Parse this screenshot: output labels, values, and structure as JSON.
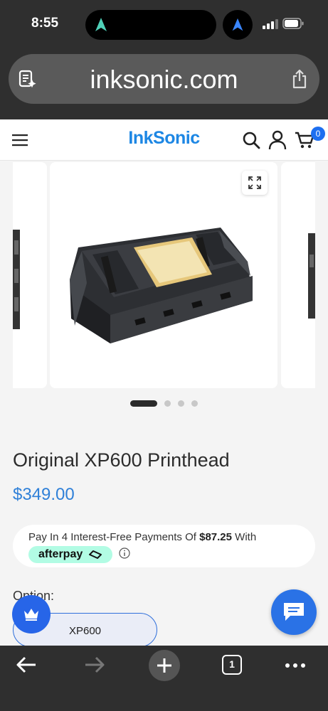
{
  "status_bar": {
    "time": "8:55"
  },
  "browser": {
    "url": "inksonic.com",
    "tab_count": "1"
  },
  "site": {
    "logo": "InkSonic",
    "cart_count": "0"
  },
  "gallery": {
    "slide_count": 4,
    "active_index": 0
  },
  "product": {
    "title": "Original XP600 Printhead",
    "price": "$349.00"
  },
  "afterpay": {
    "text_before": "Pay In 4 Interest-Free Payments Of",
    "amount": "$87.25",
    "text_after": "With",
    "brand": "afterpay"
  },
  "option": {
    "label": "Option:",
    "selected": "XP600"
  },
  "colors": {
    "accent": "#2f80d8",
    "brand": "#1d87e4",
    "afterpay_mint": "#b2fce4",
    "chat_button": "#2a72e6"
  }
}
